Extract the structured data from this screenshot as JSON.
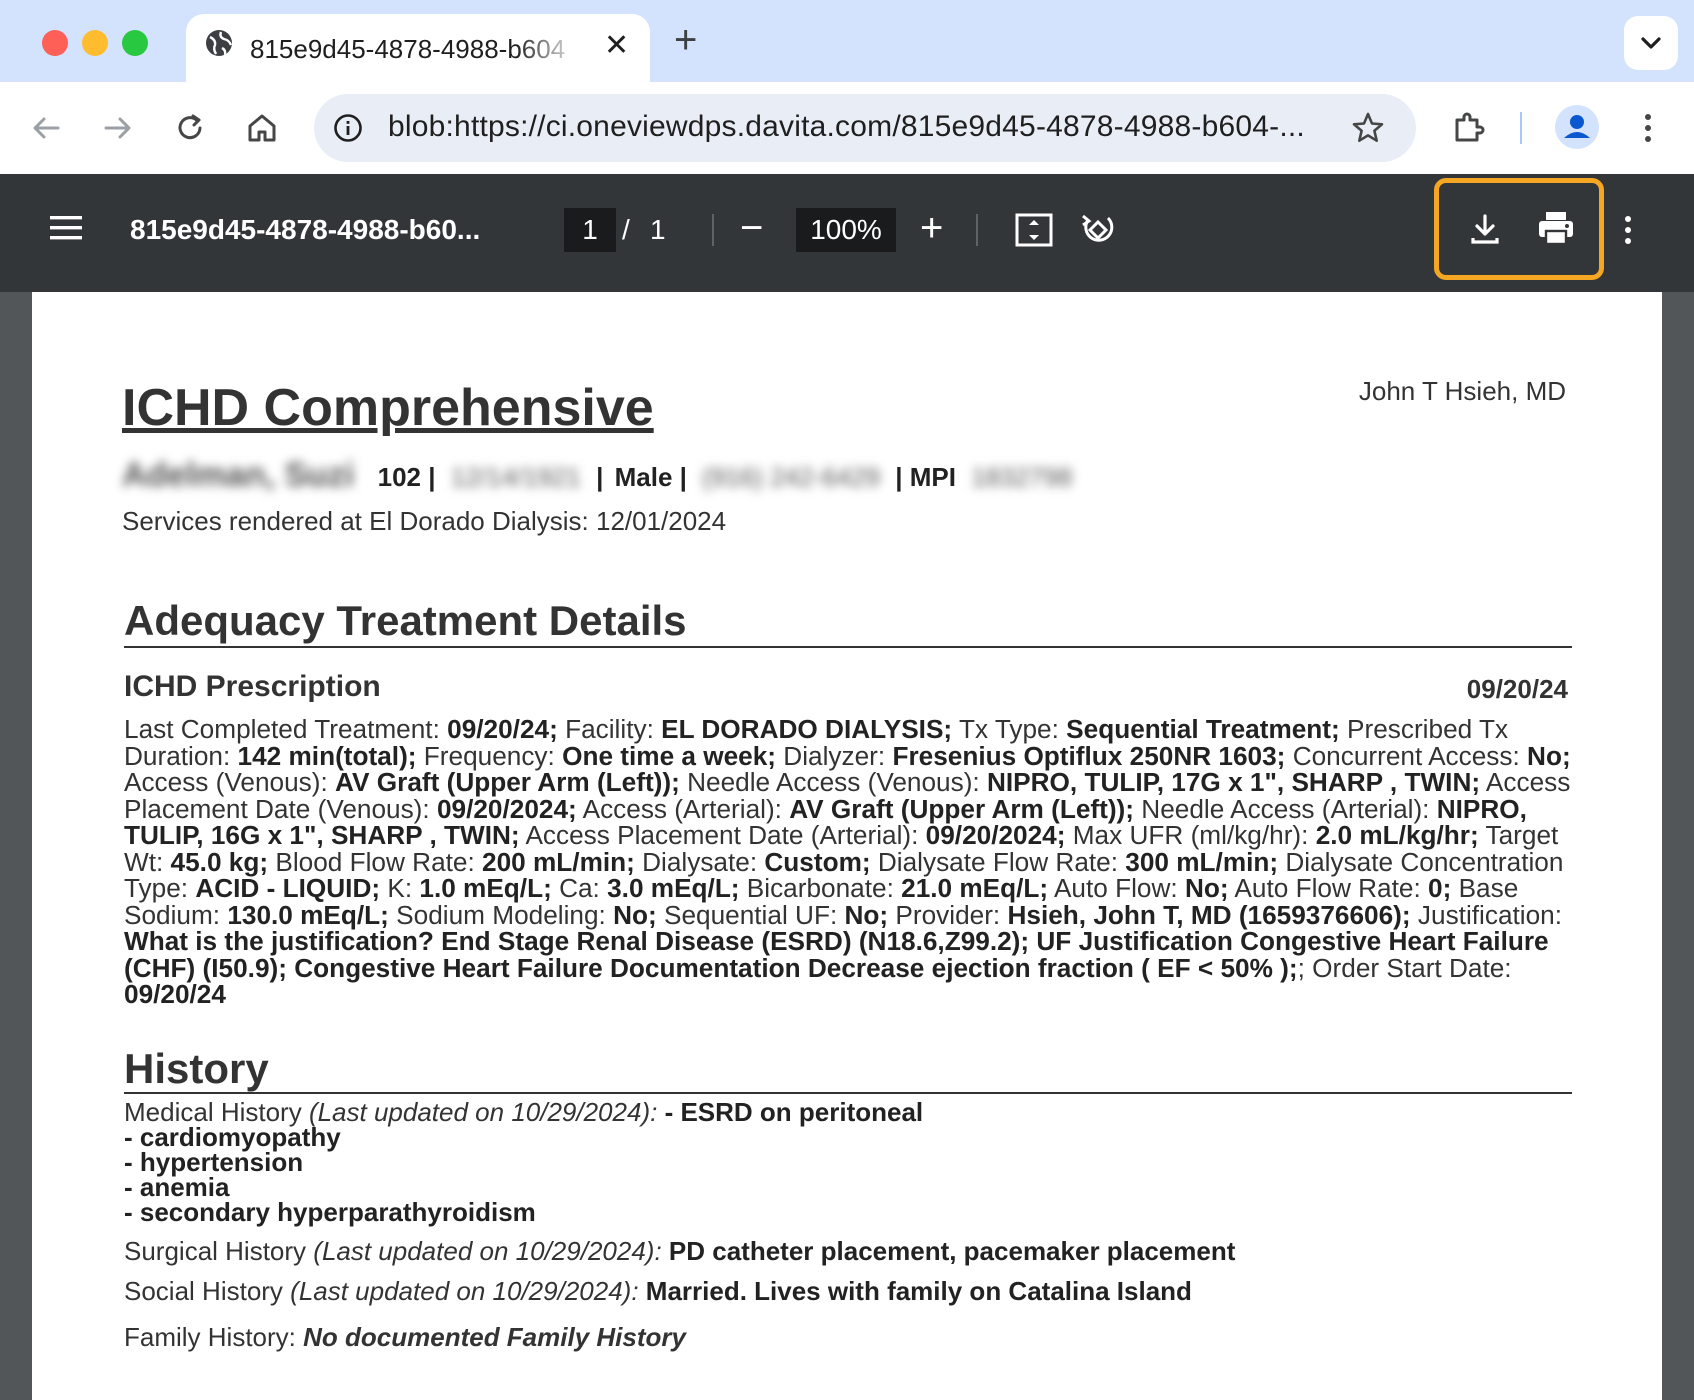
{
  "browser": {
    "tab_title": "815e9d45-4878-4988-b604",
    "new_tab_label": "+",
    "url": "blob:https://ci.oneviewdps.davita.com/815e9d45-4878-4988-b604-..."
  },
  "pdf_viewer": {
    "file_title": "815e9d45-4878-4988-b60...",
    "current_page": "1",
    "page_separator": "/",
    "total_pages": "1",
    "zoom": "100%",
    "zoom_out": "−",
    "zoom_in": "+"
  },
  "document": {
    "title": "ICHD Comprehensive",
    "doctor": "John T Hsieh, MD",
    "patient": {
      "name": "Adelman, Suzi",
      "room": "102 |",
      "dob": "12/14/1921",
      "sep1": "|",
      "sex": "Male |",
      "phone": "(916) 242-6429",
      "mpi_label": "| MPI",
      "mpi": "1832798"
    },
    "services": "Services rendered at El Dorado Dialysis: 12/01/2024",
    "section1_title": "Adequacy Treatment Details",
    "prescription_title": "ICHD Prescription",
    "prescription_date": "09/20/24",
    "prescription_segments": [
      {
        "t": "Last Completed Treatment: ",
        "b": false
      },
      {
        "t": "09/20/24;",
        "b": true
      },
      {
        "t": " Facility: ",
        "b": false
      },
      {
        "t": "EL DORADO DIALYSIS;",
        "b": true
      },
      {
        "t": " Tx Type: ",
        "b": false
      },
      {
        "t": "Sequential Treatment;",
        "b": true
      },
      {
        "t": " Prescribed Tx Duration: ",
        "b": false
      },
      {
        "t": "142 min(total);",
        "b": true
      },
      {
        "t": " Frequency: ",
        "b": false
      },
      {
        "t": "One time a week;",
        "b": true
      },
      {
        "t": " Dialyzer: ",
        "b": false
      },
      {
        "t": "Fresenius Optiflux 250NR 1603;",
        "b": true
      },
      {
        "t": " Concurrent Access: ",
        "b": false
      },
      {
        "t": "No;",
        "b": true
      },
      {
        "t": " Access (Venous): ",
        "b": false
      },
      {
        "t": "AV Graft (Upper Arm (Left));",
        "b": true
      },
      {
        "t": " Needle Access (Venous): ",
        "b": false
      },
      {
        "t": "NIPRO, TULIP, 17G x 1\", SHARP , TWIN;",
        "b": true
      },
      {
        "t": " Access Placement Date (Venous): ",
        "b": false
      },
      {
        "t": "09/20/2024;",
        "b": true
      },
      {
        "t": " Access (Arterial): ",
        "b": false
      },
      {
        "t": "AV Graft (Upper Arm (Left));",
        "b": true
      },
      {
        "t": " Needle Access (Arterial): ",
        "b": false
      },
      {
        "t": "NIPRO, TULIP, 16G x 1\", SHARP , TWIN;",
        "b": true
      },
      {
        "t": " Access Placement Date (Arterial): ",
        "b": false
      },
      {
        "t": "09/20/2024;",
        "b": true
      },
      {
        "t": " Max UFR (ml/kg/hr): ",
        "b": false
      },
      {
        "t": "2.0 mL/kg/hr;",
        "b": true
      },
      {
        "t": " Target Wt: ",
        "b": false
      },
      {
        "t": "45.0 kg;",
        "b": true
      },
      {
        "t": " Blood Flow Rate: ",
        "b": false
      },
      {
        "t": "200 mL/min;",
        "b": true
      },
      {
        "t": " Dialysate: ",
        "b": false
      },
      {
        "t": "Custom;",
        "b": true
      },
      {
        "t": " Dialysate Flow Rate: ",
        "b": false
      },
      {
        "t": "300 mL/min;",
        "b": true
      },
      {
        "t": " Dialysate Concentration Type: ",
        "b": false
      },
      {
        "t": "ACID - LIQUID;",
        "b": true
      },
      {
        "t": " K: ",
        "b": false
      },
      {
        "t": "1.0 mEq/L;",
        "b": true
      },
      {
        "t": " Ca: ",
        "b": false
      },
      {
        "t": "3.0 mEq/L;",
        "b": true
      },
      {
        "t": " Bicarbonate: ",
        "b": false
      },
      {
        "t": "21.0 mEq/L;",
        "b": true
      },
      {
        "t": " Auto Flow: ",
        "b": false
      },
      {
        "t": "No;",
        "b": true
      },
      {
        "t": " Auto Flow Rate: ",
        "b": false
      },
      {
        "t": "0;",
        "b": true
      },
      {
        "t": " Base Sodium: ",
        "b": false
      },
      {
        "t": "130.0 mEq/L;",
        "b": true
      },
      {
        "t": " Sodium Modeling: ",
        "b": false
      },
      {
        "t": "No;",
        "b": true
      },
      {
        "t": " Sequential UF: ",
        "b": false
      },
      {
        "t": "No;",
        "b": true
      },
      {
        "t": " Provider: ",
        "b": false
      },
      {
        "t": "Hsieh, John T, MD (1659376606);",
        "b": true
      },
      {
        "t": " Justification: ",
        "b": false
      },
      {
        "t": "What is the justification? End Stage Renal Disease (ESRD) (N18.6,Z99.2); UF Justification Congestive Heart Failure (CHF) (I50.9); Congestive Heart Failure Documentation Decrease ejection fraction ( EF < 50% );",
        "b": true
      },
      {
        "t": "; Order Start Date: ",
        "b": false
      },
      {
        "t": "09/20/24",
        "b": true
      }
    ],
    "history_title": "History",
    "medical_history": {
      "label": "Medical History ",
      "updated": "(Last updated on 10/29/2024):",
      "items": [
        "- ESRD on peritoneal",
        "- cardiomyopathy",
        "- hypertension",
        "- anemia",
        "- secondary hyperparathyroidism"
      ]
    },
    "surgical_history": {
      "label": "Surgical History ",
      "updated": "(Last updated on 10/29/2024):",
      "value": "PD catheter placement, pacemaker placement"
    },
    "social_history": {
      "label": "Social History ",
      "updated": "(Last updated on 10/29/2024):",
      "value": "Married. Lives with family on Catalina Island"
    },
    "family_history": {
      "label": "Family History: ",
      "value": "No documented Family History"
    }
  },
  "colors": {
    "tab_strip": "#d3e3fd",
    "pdf_toolbar": "#323639",
    "highlight": "#f5a623"
  }
}
